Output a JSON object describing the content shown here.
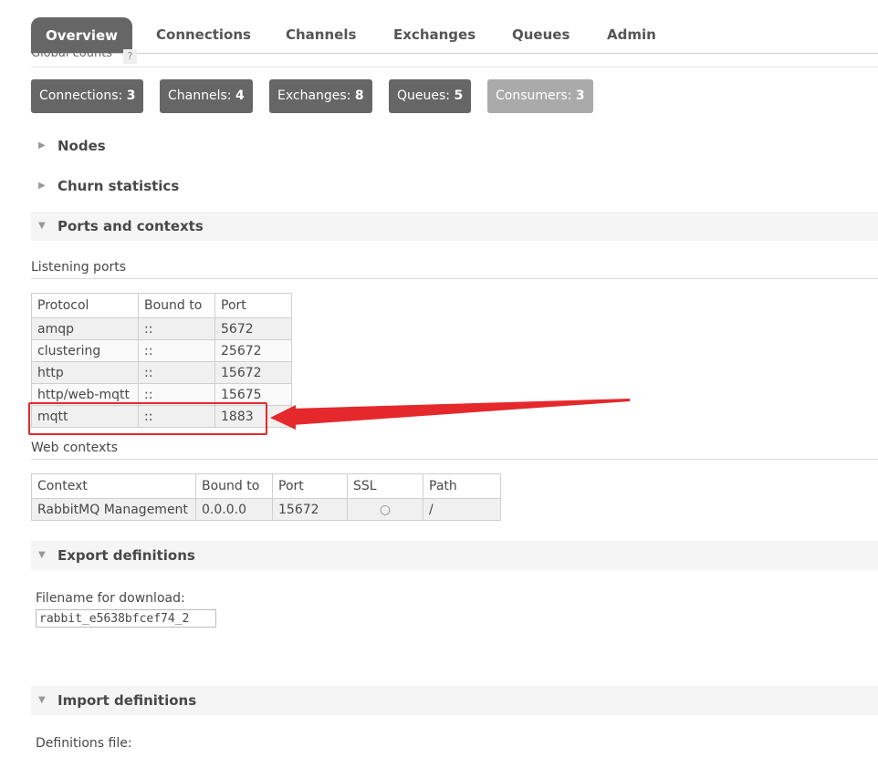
{
  "tabs": [
    {
      "label": "Overview",
      "active": true
    },
    {
      "label": "Connections"
    },
    {
      "label": "Channels"
    },
    {
      "label": "Exchanges"
    },
    {
      "label": "Queues"
    },
    {
      "label": "Admin"
    }
  ],
  "global_counts": {
    "label": "Global counts",
    "help": "?",
    "items": [
      {
        "label": "Connections:",
        "value": "3"
      },
      {
        "label": "Channels:",
        "value": "4"
      },
      {
        "label": "Exchanges:",
        "value": "8"
      },
      {
        "label": "Queues:",
        "value": "5"
      },
      {
        "label": "Consumers:",
        "value": "3"
      }
    ]
  },
  "sections": {
    "nodes": "Nodes",
    "churn": "Churn statistics",
    "ports_contexts": "Ports and contexts",
    "export": "Export definitions",
    "import": "Import definitions"
  },
  "listening_ports": {
    "heading": "Listening ports",
    "columns": [
      "Protocol",
      "Bound to",
      "Port"
    ],
    "rows": [
      [
        "amqp",
        "::",
        "5672"
      ],
      [
        "clustering",
        "::",
        "25672"
      ],
      [
        "http",
        "::",
        "15672"
      ],
      [
        "http/web-mqtt",
        "::",
        "15675"
      ],
      [
        "mqtt",
        "::",
        "1883"
      ]
    ]
  },
  "web_contexts": {
    "heading": "Web contexts",
    "columns": [
      "Context",
      "Bound to",
      "Port",
      "SSL",
      "Path"
    ],
    "rows": [
      [
        "RabbitMQ Management",
        "0.0.0.0",
        "15672",
        "○",
        "/"
      ]
    ]
  },
  "export": {
    "filename_label": "Filename for download:",
    "filename_value": "rabbit_e5638bfcef74_2"
  },
  "import": {
    "file_label": "Definitions file:"
  },
  "colors": {
    "tab_active": "#666666",
    "count_button": "#666666",
    "count_button_light": "#aaaaaa",
    "annotation": "#e5282c"
  }
}
